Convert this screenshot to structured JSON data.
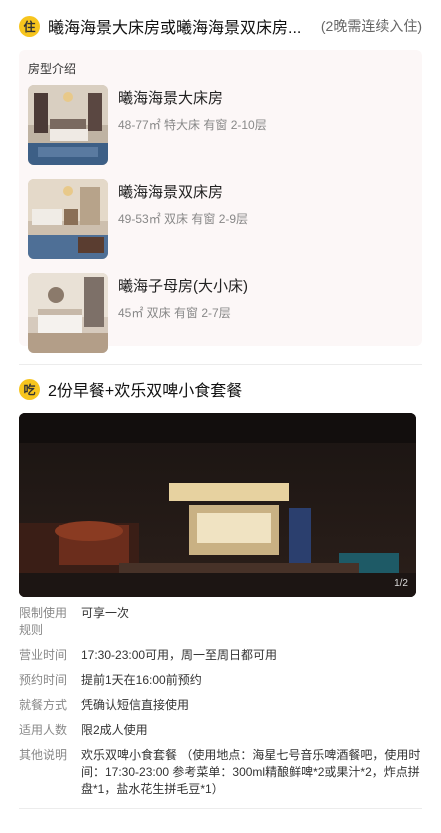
{
  "hotel_section": {
    "badge": "住",
    "title": "曦海海景大床房或曦海海景双床房...",
    "note": "(2晚需连续入住)",
    "box_title": "房型介绍",
    "rooms": [
      {
        "name": "曦海海景大床房",
        "meta": "48-77㎡  特大床  有窗  2-10层"
      },
      {
        "name": "曦海海景双床房",
        "meta": "49-53㎡  双床  有窗  2-9层"
      },
      {
        "name": "曦海子母房(大小床)",
        "meta": "45㎡  双床  有窗  2-7层"
      }
    ]
  },
  "food_section": {
    "badge": "吃",
    "title": "2份早餐+欢乐双啤小食套餐",
    "photo_counter": "1/2",
    "details": [
      {
        "label": "限制使用规则",
        "value": "可享一次"
      },
      {
        "label": "营业时间",
        "value": "17:30-23:00可用，周一至周日都可用"
      },
      {
        "label": "预约时间",
        "value": "提前1天在16:00前预约"
      },
      {
        "label": "就餐方式",
        "value": "凭确认短信直接使用"
      },
      {
        "label": "适用人数",
        "value": "限2成人使用"
      },
      {
        "label": "其他说明",
        "value": "欢乐双啤小食套餐 （使用地点：海星七号音乐啤酒餐吧，使用时间：17:30-23:00 参考菜单：300ml精酿鲜啤*2或果汁*2，炸点拼盘*1，盐水花生拼毛豆*1）"
      }
    ]
  }
}
